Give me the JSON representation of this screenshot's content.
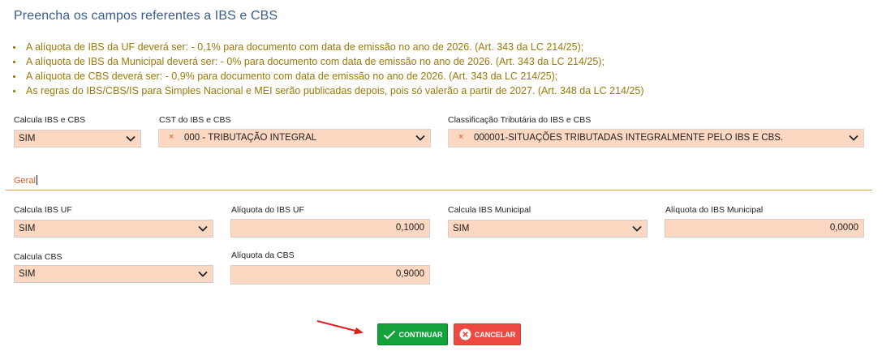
{
  "page": {
    "title": "Preencha os campos referentes a IBS e CBS"
  },
  "notes": [
    "A alíquota de IBS da UF deverá ser: - 0,1% para documento com data de emissão no ano de 2026. (Art. 343 da LC 214/25);",
    "A alíquota de IBS da Municipal deverá ser: - 0% para documento com data de emissão no ano de 2026. (Art. 343 da LC 214/25);",
    "A alíquota de CBS deverá ser: - 0,9% para documento com data de emissão no ano de 2026. (Art. 343 da LC 214/25);",
    "As regras do IBS/CBS/IS para Simples Nacional e MEI serão publicadas depois, pois só valerão a partir de 2027. (Art. 348 da LC 214/25)"
  ],
  "top_fields": {
    "calcula_ibs_cbs": {
      "label": "Calcula IBS e CBS",
      "value": "SIM"
    },
    "cst": {
      "label": "CST do IBS e CBS",
      "value": "000 - TRIBUTAÇÃO INTEGRAL",
      "remove_glyph": "×"
    },
    "classificacao": {
      "label": "Classificação Tributária do IBS e CBS",
      "value": "000001-SITUAÇÕES TRIBUTADAS INTEGRALMENTE PELO IBS E CBS.",
      "remove_glyph": "×"
    }
  },
  "section": {
    "label": "Geral"
  },
  "geral_fields": {
    "calcula_ibs_uf": {
      "label": "Calcula IBS UF",
      "value": "SIM"
    },
    "aliquota_ibs_uf": {
      "label": "Alíquota do IBS UF",
      "value": "0,1000"
    },
    "calcula_ibs_municipal": {
      "label": "Calcula IBS Municipal",
      "value": "SIM"
    },
    "aliquota_ibs_municipal": {
      "label": "Alíquota do IBS Municipal",
      "value": "0,0000"
    },
    "calcula_cbs": {
      "label": "Calcula CBS",
      "value": "SIM"
    },
    "aliquota_cbs": {
      "label": "Alíquota da CBS",
      "value": "0,9000"
    }
  },
  "buttons": {
    "continuar": "CONTINUAR",
    "cancelar": "CANCELAR"
  },
  "colors": {
    "title": "#3b5c8c",
    "notes": "#9a7a08",
    "field_bg": "#fcd7c1",
    "section_accent": "#e05a1e",
    "continue_button": "#15a23b",
    "cancel_button": "#ed4a41",
    "annotation_arrow": "#e0201c"
  },
  "icons": {
    "continue": "check-icon",
    "cancel": "close-circle-icon",
    "select": "chevron-down-icon",
    "annotation": "red-arrow"
  }
}
